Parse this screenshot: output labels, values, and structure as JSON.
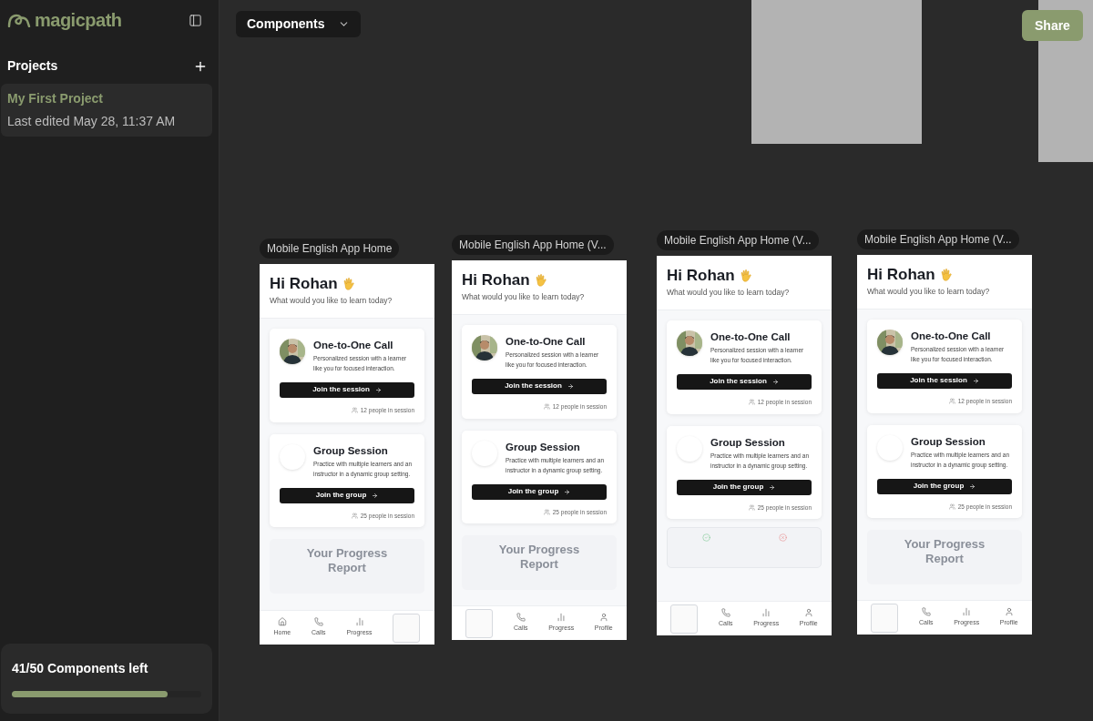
{
  "sidebar": {
    "logo": "magicpath",
    "projects_label": "Projects",
    "projects": [
      {
        "name": "My First Project",
        "subtitle": "Last edited May 28, 11:37 AM",
        "selected": true
      }
    ],
    "quota": {
      "text": "41/50 Components left",
      "level": 0.82
    }
  },
  "toolbar": {
    "dropdown": "Components",
    "share": "Share"
  },
  "frames": [
    {
      "label": "Mobile English App Home",
      "greeting": "Hi Rohan",
      "subtitle": "What would you like to learn today?",
      "cards": [
        {
          "title": "One-to-One Call",
          "description": "Personalized session with a learner like you for focused interaction.",
          "button": "Join the session",
          "count": "12 people in session"
        },
        {
          "kind": "blank",
          "title": "Group Session",
          "description": "Practice with multiple learners and an instructor in a dynamic group setting.",
          "button": "Join the group",
          "count": "25 people in session"
        }
      ],
      "progress": {
        "kind": "title",
        "text": "Your Progress Report"
      },
      "nav": [
        {
          "kind": "home",
          "label": "Home"
        },
        {
          "kind": "calls",
          "label": "Calls"
        },
        {
          "kind": "progress",
          "label": "Progress"
        },
        {
          "kind": "blank"
        }
      ]
    },
    {
      "label": "Mobile English App Home (V...",
      "greeting": "Hi Rohan",
      "subtitle": "What would you like to learn today?",
      "cards": [
        {
          "title": "One-to-One Call",
          "description": "Personalized session with a learner like you for focused interaction.",
          "button": "Join the session",
          "count": "12 people in session"
        },
        {
          "kind": "blank",
          "title": "Group Session",
          "description": "Practice with multiple learners and an instructor in a dynamic group setting.",
          "button": "Join the group",
          "count": "25 people in session"
        }
      ],
      "progress": {
        "kind": "title",
        "text": "Your Progress Report"
      },
      "nav": [
        {
          "kind": "blank"
        },
        {
          "kind": "calls",
          "label": "Calls"
        },
        {
          "kind": "progress",
          "label": "Progress"
        },
        {
          "kind": "profile",
          "label": "Profile"
        }
      ]
    },
    {
      "label": "Mobile English App Home (V...",
      "greeting": "Hi Rohan",
      "subtitle": "What would you like to learn today?",
      "cards": [
        {
          "title": "One-to-One Call",
          "description": "Personalized session with a learner like you for focused interaction.",
          "button": "Join the session",
          "count": "12 people in session"
        },
        {
          "kind": "blank",
          "title": "Group Session",
          "description": "Practice with multiple learners and an instructor in a dynamic group setting.",
          "button": "Join the group",
          "count": "25 people in session"
        }
      ],
      "progress": {
        "kind": "stats"
      },
      "nav": [
        {
          "kind": "blank"
        },
        {
          "kind": "calls",
          "label": "Calls"
        },
        {
          "kind": "progress",
          "label": "Progress"
        },
        {
          "kind": "profile",
          "label": "Profile"
        }
      ]
    },
    {
      "label": "Mobile English App Home (V...",
      "greeting": "Hi Rohan",
      "subtitle": "What would you like to learn today?",
      "cards": [
        {
          "title": "One-to-One Call",
          "description": "Personalized session with a learner like you for focused interaction.",
          "button": "Join the session",
          "count": "12 people in session"
        },
        {
          "kind": "blank",
          "title": "Group Session",
          "description": "Practice with multiple learners and an instructor in a dynamic group setting.",
          "button": "Join the group",
          "count": "25 people in session"
        }
      ],
      "progress": {
        "kind": "title",
        "text": "Your Progress Report"
      },
      "nav": [
        {
          "kind": "blank"
        },
        {
          "kind": "calls",
          "label": "Calls"
        },
        {
          "kind": "progress",
          "label": "Progress"
        },
        {
          "kind": "profile",
          "label": "Profile"
        }
      ]
    }
  ]
}
